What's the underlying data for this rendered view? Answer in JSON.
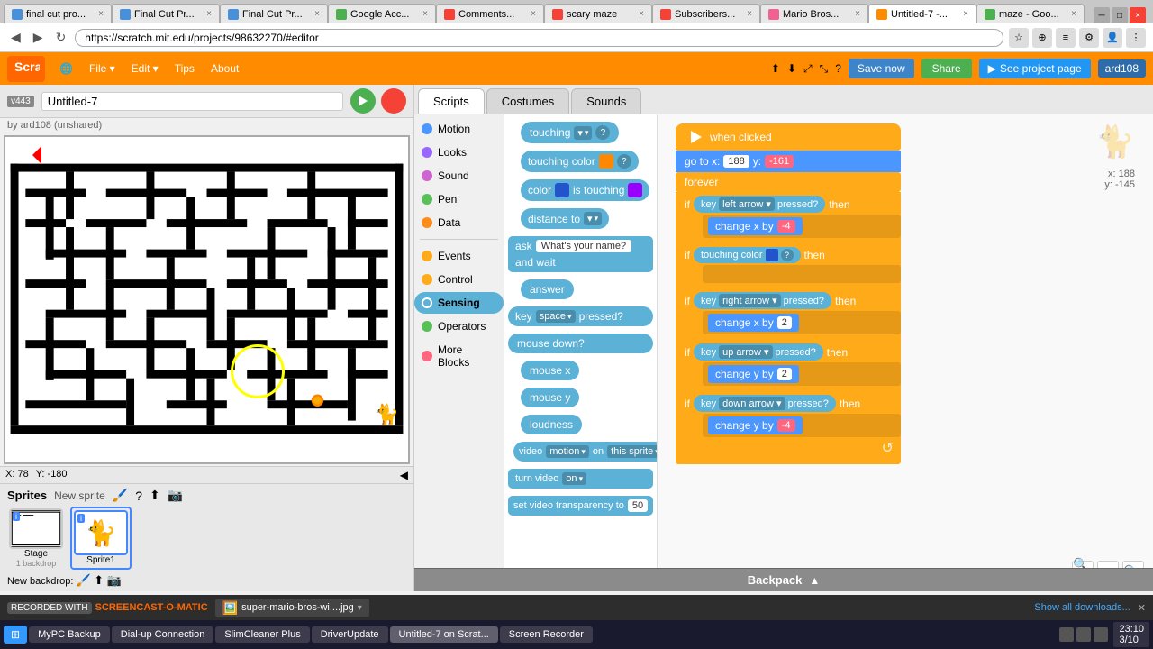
{
  "browser": {
    "url": "https://scratch.mit.edu/projects/98632270/#editor",
    "tabs": [
      {
        "label": "final cut pro...",
        "active": false,
        "color": "#4a90d9"
      },
      {
        "label": "Final Cut Pr...",
        "active": false,
        "color": "#4a90d9"
      },
      {
        "label": "Final Cut Pr...",
        "active": false,
        "color": "#4a90d9"
      },
      {
        "label": "Google Acc...",
        "active": false,
        "color": "#4caf50"
      },
      {
        "label": "Comments...",
        "active": false,
        "color": "#f44336"
      },
      {
        "label": "scary maze",
        "active": false,
        "color": "#f44336"
      },
      {
        "label": "Subscribers...",
        "active": false,
        "color": "#f44336"
      },
      {
        "label": "Mario Bros...",
        "active": false,
        "color": "#f06292"
      },
      {
        "label": "Untitled-7 -...",
        "active": true,
        "color": "#ff8c00"
      },
      {
        "label": "maze - Goo...",
        "active": false,
        "color": "#4caf50"
      }
    ]
  },
  "scratch": {
    "project_title": "Untitled-7",
    "author": "by ard108 (unshared)",
    "save_label": "Save now",
    "username": "ard108",
    "share_label": "Share",
    "see_project_label": "See project page"
  },
  "tabs": {
    "scripts_label": "Scripts",
    "costumes_label": "Costumes",
    "sounds_label": "Sounds",
    "active": "Scripts"
  },
  "categories": [
    {
      "id": "motion",
      "label": "Motion",
      "color": "#4c97ff"
    },
    {
      "id": "looks",
      "label": "Looks",
      "color": "#9966ff"
    },
    {
      "id": "sound",
      "label": "Sound",
      "color": "#cf63cf"
    },
    {
      "id": "pen",
      "label": "Pen",
      "color": "#59c059"
    },
    {
      "id": "data",
      "label": "Data",
      "color": "#ff8c1a"
    },
    {
      "id": "events",
      "label": "Events",
      "color": "#ffab19"
    },
    {
      "id": "control",
      "label": "Control",
      "color": "#ffab19"
    },
    {
      "id": "sensing",
      "label": "Sensing",
      "color": "#5cb1d6",
      "active": true
    },
    {
      "id": "operators",
      "label": "Operators",
      "color": "#59c059"
    },
    {
      "id": "more_blocks",
      "label": "More Blocks",
      "color": "#ff6680"
    }
  ],
  "sensing_blocks": [
    {
      "label": "touching",
      "type": "boolean",
      "has_dropdown": true
    },
    {
      "label": "touching color",
      "type": "boolean",
      "has_dropdown": true
    },
    {
      "label": "color is touching",
      "type": "boolean",
      "has_color": true
    },
    {
      "label": "distance to",
      "type": "reporter",
      "has_dropdown": true
    },
    {
      "label": "ask What's your name? and wait",
      "type": "command"
    },
    {
      "label": "answer",
      "type": "reporter"
    },
    {
      "label": "key space pressed?",
      "type": "boolean",
      "has_dropdown": true
    },
    {
      "label": "mouse down?",
      "type": "boolean"
    },
    {
      "label": "mouse x",
      "type": "reporter"
    },
    {
      "label": "mouse y",
      "type": "reporter"
    },
    {
      "label": "loudness",
      "type": "reporter"
    },
    {
      "label": "video motion on this sprite",
      "type": "reporter"
    },
    {
      "label": "turn video on",
      "type": "command",
      "has_dropdown": true
    },
    {
      "label": "set video transparency to 50",
      "type": "command"
    }
  ],
  "sprites": {
    "label": "Sprites",
    "new_sprite_label": "New sprite",
    "items": [
      {
        "name": "Stage",
        "sub": "1 backdrop",
        "is_stage": true
      },
      {
        "name": "Sprite1",
        "selected": true
      }
    ],
    "new_backdrop_label": "New backdrop:"
  },
  "script": {
    "when_flag_clicked": "when clicked",
    "go_to_label": "go to x:",
    "go_to_x": "188",
    "go_to_y": "-161",
    "forever_label": "forever",
    "blocks": [
      {
        "type": "if",
        "condition": "key left arrow pressed?",
        "then": "change x by -4"
      },
      {
        "type": "if_touching_color",
        "condition": "touching color ? then"
      },
      {
        "type": "if",
        "condition": "key right arrow pressed?",
        "then": "change x by 2"
      },
      {
        "type": "if",
        "condition": "key up arrow pressed?",
        "then": "change y by 2"
      },
      {
        "type": "if",
        "condition": "key down arrow pressed?",
        "then": "change y by -4"
      }
    ]
  },
  "coord_display": {
    "x_label": "x: 188",
    "y_label": "y: -145"
  },
  "stage_coords": {
    "x_label": "X: 78",
    "y_label": "Y: -180"
  },
  "backpack": {
    "label": "Backpack"
  },
  "bottom_bar": {
    "recorded_label": "RECORDED WITH",
    "app_label": "SCREENCAST-O-MATIC",
    "file_label": "super-mario-bros-wi....jpg",
    "downloads_label": "Show all downloads...",
    "close_label": "✕"
  },
  "taskbar": {
    "items": [
      {
        "label": "MyPC Backup"
      },
      {
        "label": "Dial-up Connection"
      },
      {
        "label": "SlimCleaner Plus"
      },
      {
        "label": "DriverUpdate"
      },
      {
        "label": "Untitled-7 on Scrat...",
        "active": true
      },
      {
        "label": "Screen Recorder"
      }
    ],
    "time": "23:10",
    "date": "3/10"
  }
}
